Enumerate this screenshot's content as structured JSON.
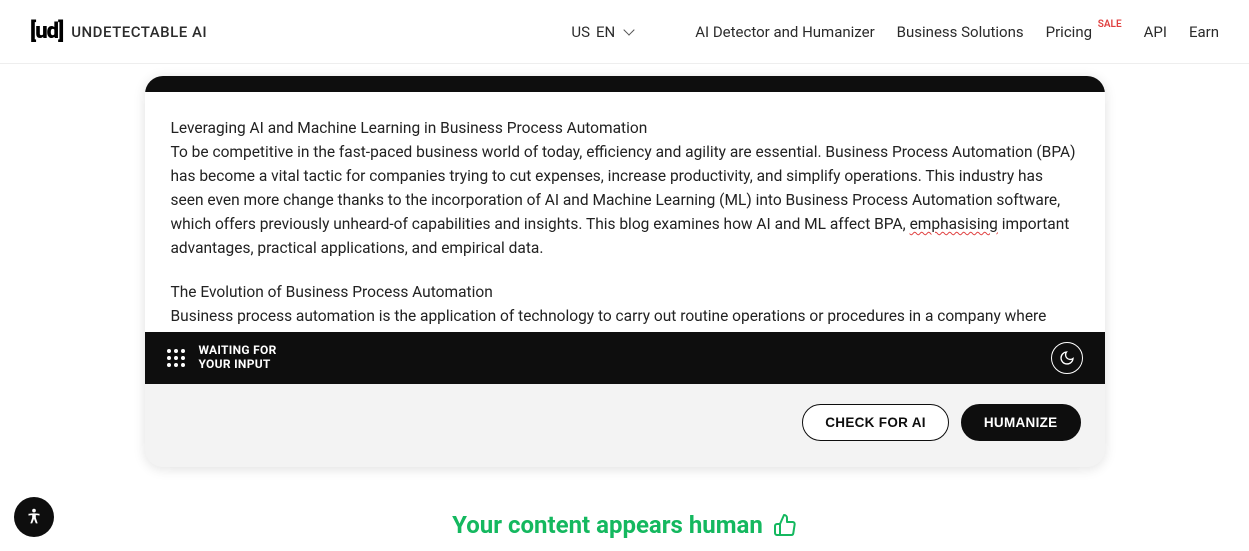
{
  "header": {
    "logo_icon": "[ud]",
    "logo_text": "UNDETECTABLE AI",
    "locale_country": "US",
    "locale_lang": "EN",
    "nav": {
      "detector": "AI Detector and Humanizer",
      "business": "Business Solutions",
      "pricing": "Pricing",
      "pricing_badge": "SALE",
      "api": "API",
      "earn": "Earn"
    }
  },
  "widget": {
    "content_title": "Leveraging AI and Machine Learning in Business Process Automation",
    "content_p1_a": "To be competitive in the fast-paced business world of today, efficiency and agility are essential. Business Process Automation (BPA) has become a vital tactic for companies trying to cut expenses, increase productivity, and simplify operations. This industry has seen even more change thanks to the incorporation of AI and Machine Learning (ML) into Business Process Automation software, which offers previously unheard-of capabilities and insights. This blog examines how AI and ML affect BPA, ",
    "content_p1_spell": "emphasising",
    "content_p1_b": " important advantages, practical applications, and empirical data.",
    "content_h2": "The Evolution of Business Process Automation",
    "content_p2": "Business process automation is the application of technology to carry out routine operations or procedures in a company where human labor can be substituted. These cover a variety of duties including processing invoices, providing customer",
    "status_line1": "WAITING FOR",
    "status_line2": "YOUR INPUT",
    "btn_check": "CHECK FOR AI",
    "btn_humanize": "HUMANIZE"
  },
  "result": {
    "text": "Your content appears human"
  }
}
